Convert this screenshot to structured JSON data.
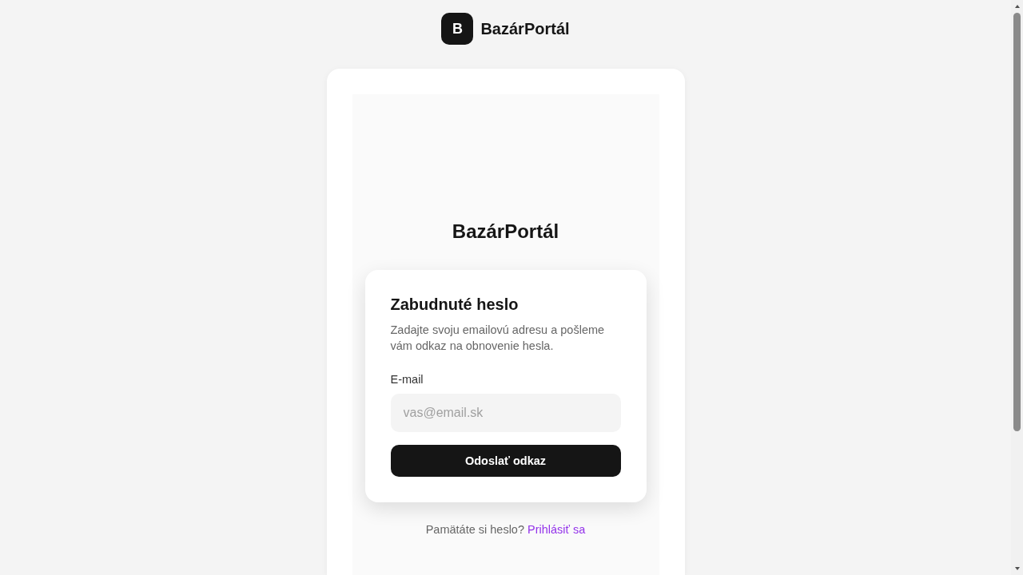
{
  "header": {
    "logo_letter": "B",
    "brand": "BazárPortál"
  },
  "panel": {
    "title": "BazárPortál"
  },
  "form": {
    "title": "Zabudnuté heslo",
    "description": "Zadajte svoju emailovú adresu a pošleme vám odkaz na obnovenie hesla.",
    "email_label": "E-mail",
    "email_placeholder": "vas@email.sk",
    "submit": "Odoslať odkaz"
  },
  "footer": {
    "prompt": "Pamätáte si heslo?",
    "link": "Prihlásiť sa"
  }
}
